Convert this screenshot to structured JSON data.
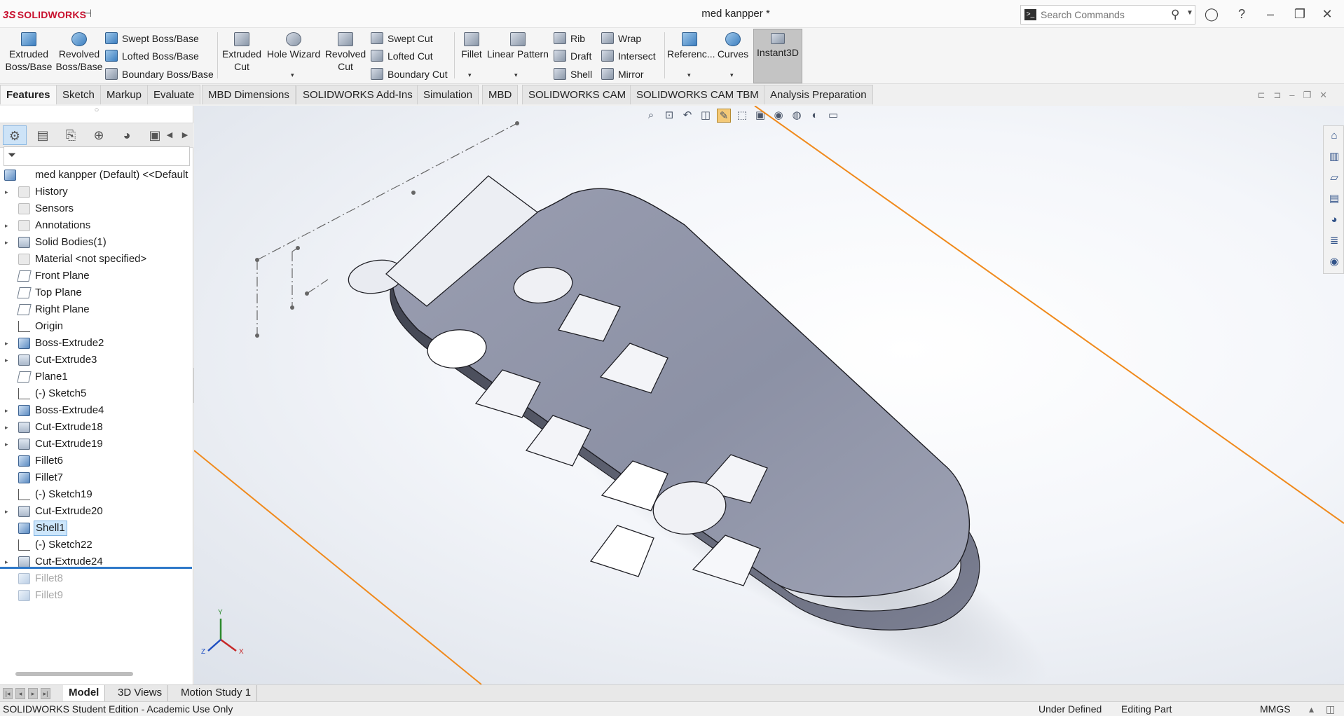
{
  "app": {
    "brand": "SOLIDWORKS",
    "document_title": "med kanpper *"
  },
  "search": {
    "placeholder": "Search Commands"
  },
  "ribbon": {
    "extruded_boss": "Extruded Boss/Base",
    "revolved_boss": "Revolved Boss/Base",
    "swept_boss": "Swept Boss/Base",
    "lofted_boss": "Lofted Boss/Base",
    "boundary_boss": "Boundary Boss/Base",
    "extruded_cut": "Extruded Cut",
    "hole_wizard": "Hole Wizard",
    "revolved_cut": "Revolved Cut",
    "swept_cut": "Swept Cut",
    "lofted_cut": "Lofted Cut",
    "boundary_cut": "Boundary Cut",
    "fillet": "Fillet",
    "linear_pattern": "Linear Pattern",
    "rib": "Rib",
    "draft": "Draft",
    "shell": "Shell",
    "wrap": "Wrap",
    "intersect": "Intersect",
    "mirror": "Mirror",
    "reference": "Referenc...",
    "curves": "Curves",
    "instant3d": "Instant3D"
  },
  "tabs": [
    "Features",
    "Sketch",
    "Markup",
    "Evaluate",
    "MBD Dimensions",
    "SOLIDWORKS Add-Ins",
    "Simulation",
    "MBD",
    "SOLIDWORKS CAM",
    "SOLIDWORKS CAM TBM",
    "Analysis Preparation"
  ],
  "feature_tree": {
    "root": "med kanpper (Default) <<Default",
    "items": [
      {
        "label": "History",
        "icon": "history-icon",
        "expand": true
      },
      {
        "label": "Sensors",
        "icon": "sensor-icon",
        "expand": false
      },
      {
        "label": "Annotations",
        "icon": "annotation-icon",
        "expand": true
      },
      {
        "label": "Solid Bodies(1)",
        "icon": "solid-bodies-icon",
        "expand": true
      },
      {
        "label": "Material <not specified>",
        "icon": "material-icon",
        "expand": false
      },
      {
        "label": "Front Plane",
        "icon": "plane-icon",
        "expand": false
      },
      {
        "label": "Top Plane",
        "icon": "plane-icon",
        "expand": false
      },
      {
        "label": "Right Plane",
        "icon": "plane-icon",
        "expand": false
      },
      {
        "label": "Origin",
        "icon": "origin-icon",
        "expand": false
      },
      {
        "label": "Boss-Extrude2",
        "icon": "extrude-icon",
        "expand": true
      },
      {
        "label": "Cut-Extrude3",
        "icon": "cut-icon",
        "expand": true
      },
      {
        "label": "Plane1",
        "icon": "plane-icon",
        "expand": false
      },
      {
        "label": "(-) Sketch5",
        "icon": "sketch-icon",
        "expand": false
      },
      {
        "label": "Boss-Extrude4",
        "icon": "extrude-icon",
        "expand": true
      },
      {
        "label": "Cut-Extrude18",
        "icon": "cut-icon",
        "expand": true
      },
      {
        "label": "Cut-Extrude19",
        "icon": "cut-icon",
        "expand": true
      },
      {
        "label": "Fillet6",
        "icon": "fillet-icon",
        "expand": false
      },
      {
        "label": "Fillet7",
        "icon": "fillet-icon",
        "expand": false
      },
      {
        "label": "(-) Sketch19",
        "icon": "sketch-icon",
        "expand": false
      },
      {
        "label": "Cut-Extrude20",
        "icon": "cut-icon",
        "expand": true
      },
      {
        "label": "Shell1",
        "icon": "shell-icon",
        "expand": false,
        "selected": true
      },
      {
        "label": "(-) Sketch22",
        "icon": "sketch-icon",
        "expand": false
      },
      {
        "label": "Cut-Extrude24",
        "icon": "cut-icon",
        "expand": true
      },
      {
        "label": "Fillet8",
        "icon": "fillet-icon",
        "expand": false,
        "suppressed": true
      },
      {
        "label": "Fillet9",
        "icon": "fillet-icon",
        "expand": false,
        "suppressed": true
      }
    ]
  },
  "triad": {
    "x": "X",
    "y": "Y",
    "z": "Z"
  },
  "bottom_tabs": [
    "Model",
    "3D Views",
    "Motion Study 1"
  ],
  "status": {
    "edition": "SOLIDWORKS Student Edition - Academic Use Only",
    "defined": "Under Defined",
    "mode": "Editing Part",
    "units": "MMGS"
  },
  "colors": {
    "accent_red": "#c8102e",
    "orange_line": "#f08a1c",
    "model_grey": "#8a8fa3",
    "selection_blue": "#cde6fb"
  }
}
